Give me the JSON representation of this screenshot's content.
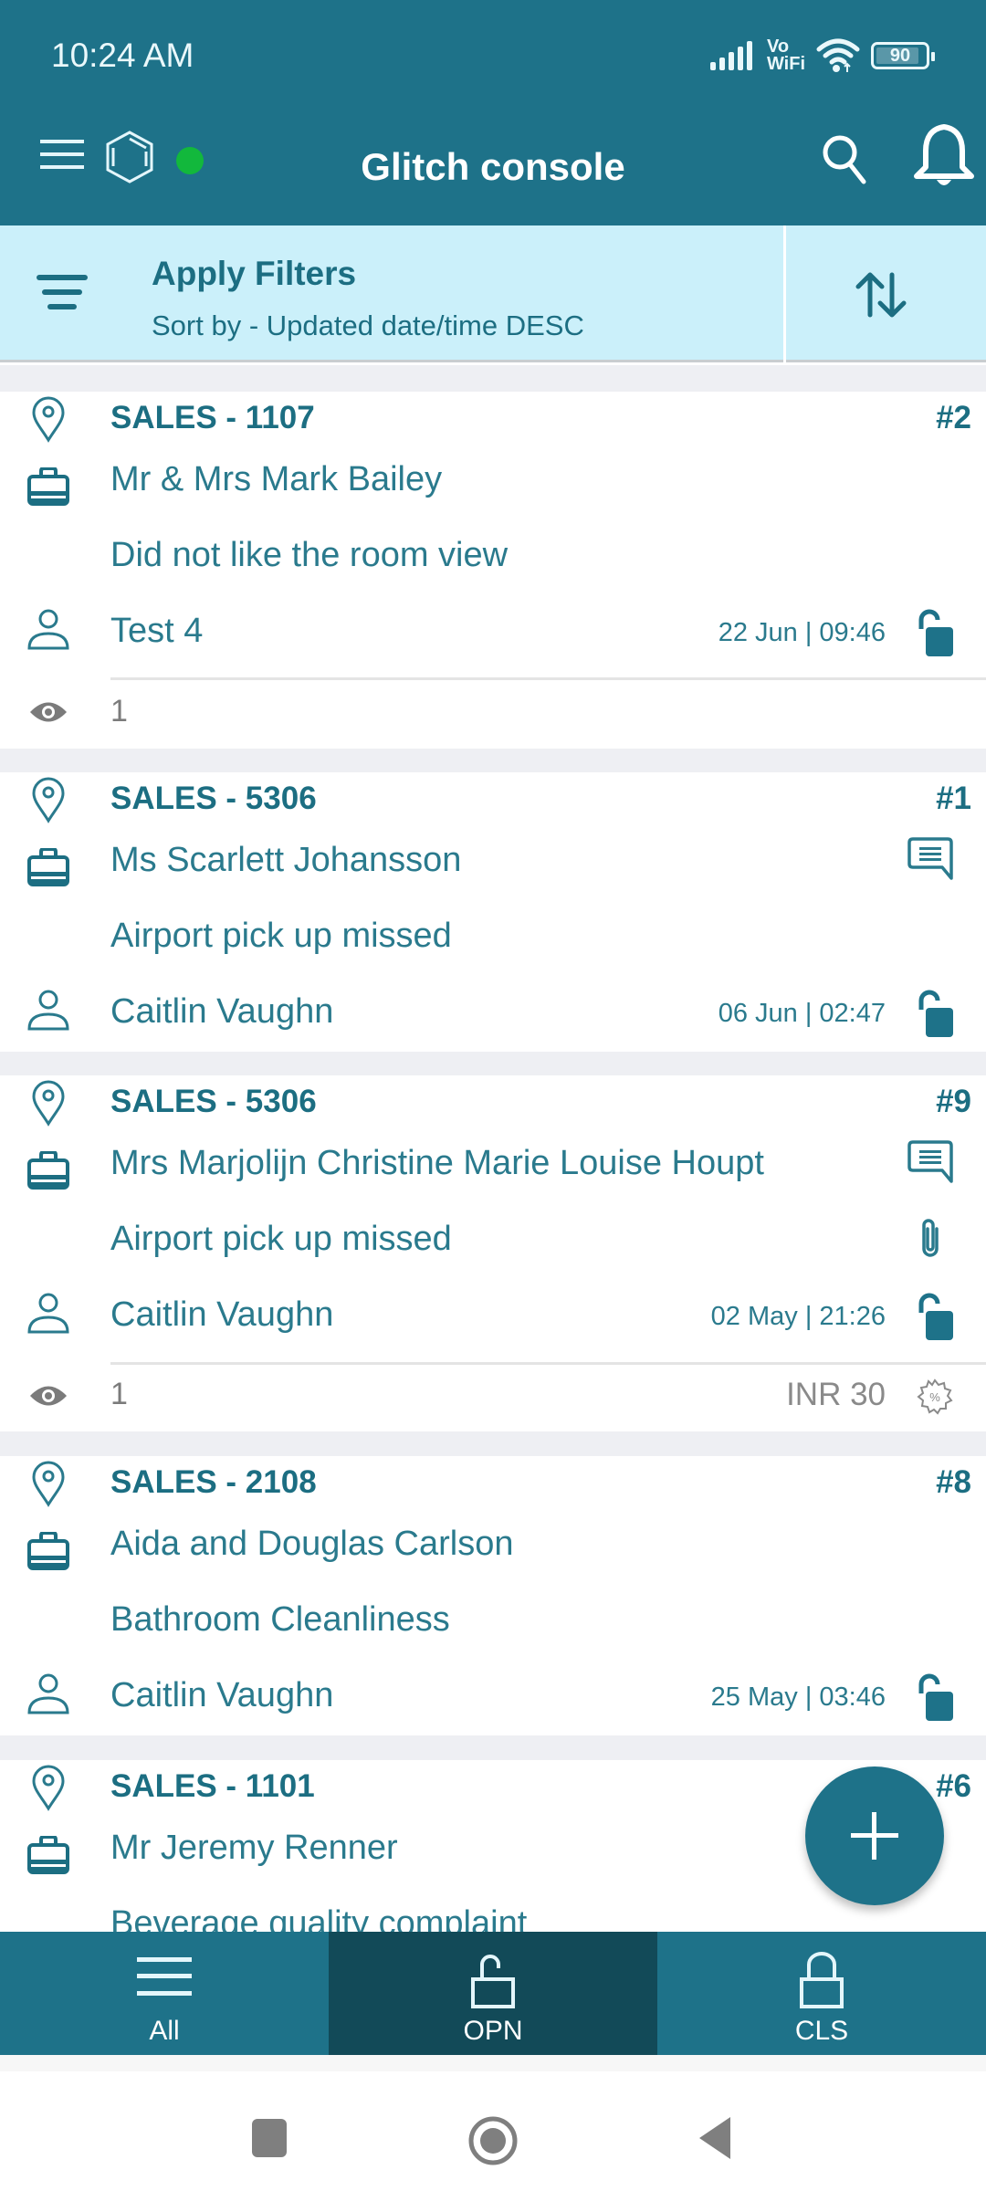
{
  "status_bar": {
    "time": "10:24 AM",
    "vowifi_top": "Vo",
    "vowifi_bottom": "WiFi",
    "battery_level": "90"
  },
  "app_bar": {
    "title": "Glitch console",
    "online_status_color": "#12b83c"
  },
  "filter_bar": {
    "title": "Apply Filters",
    "subtitle": "Sort by - Updated date/time DESC"
  },
  "tickets": [
    {
      "code": "SALES - 1107",
      "number": "#2",
      "guest": "Mr & Mrs Mark Bailey",
      "issue": "Did not like the room view",
      "assignee": "Test 4",
      "datetime": "22 Jun | 09:46",
      "status": "open",
      "has_comment": false,
      "has_attachment": false,
      "views": "1",
      "amount": ""
    },
    {
      "code": "SALES - 5306",
      "number": "#1",
      "guest": "Ms Scarlett Johansson",
      "issue": "Airport pick up missed",
      "assignee": "Caitlin Vaughn",
      "datetime": "06 Jun | 02:47",
      "status": "open",
      "has_comment": true,
      "has_attachment": false
    },
    {
      "code": "SALES - 5306",
      "number": "#9",
      "guest": "Mrs Marjolijn Christine Marie Louise Houpt",
      "issue": "Airport pick up missed",
      "assignee": "Caitlin Vaughn",
      "datetime": "02 May | 21:26",
      "status": "open",
      "has_comment": true,
      "has_attachment": true,
      "views": "1",
      "amount": "INR 30"
    },
    {
      "code": "SALES - 2108",
      "number": "#8",
      "guest": "Aida and Douglas Carlson",
      "issue": "Bathroom Cleanliness",
      "assignee": "Caitlin Vaughn",
      "datetime": "25 May | 03:46",
      "status": "open",
      "has_comment": false,
      "has_attachment": false
    },
    {
      "code": "SALES - 1101",
      "number": "#6",
      "guest": "Mr Jeremy Renner",
      "issue": "Beverage quality complaint"
    }
  ],
  "tabs": [
    {
      "label": "All",
      "icon": "list-icon",
      "active": false
    },
    {
      "label": "OPN",
      "icon": "unlock-icon",
      "active": true
    },
    {
      "label": "CLS",
      "icon": "lock-icon",
      "active": false
    }
  ],
  "colors": {
    "primary": "#1e7289",
    "primary_dark": "#124a58",
    "filter_bg": "#cbf0fa",
    "text_teal": "#1c6e82",
    "list_bg": "#eeeff3"
  }
}
